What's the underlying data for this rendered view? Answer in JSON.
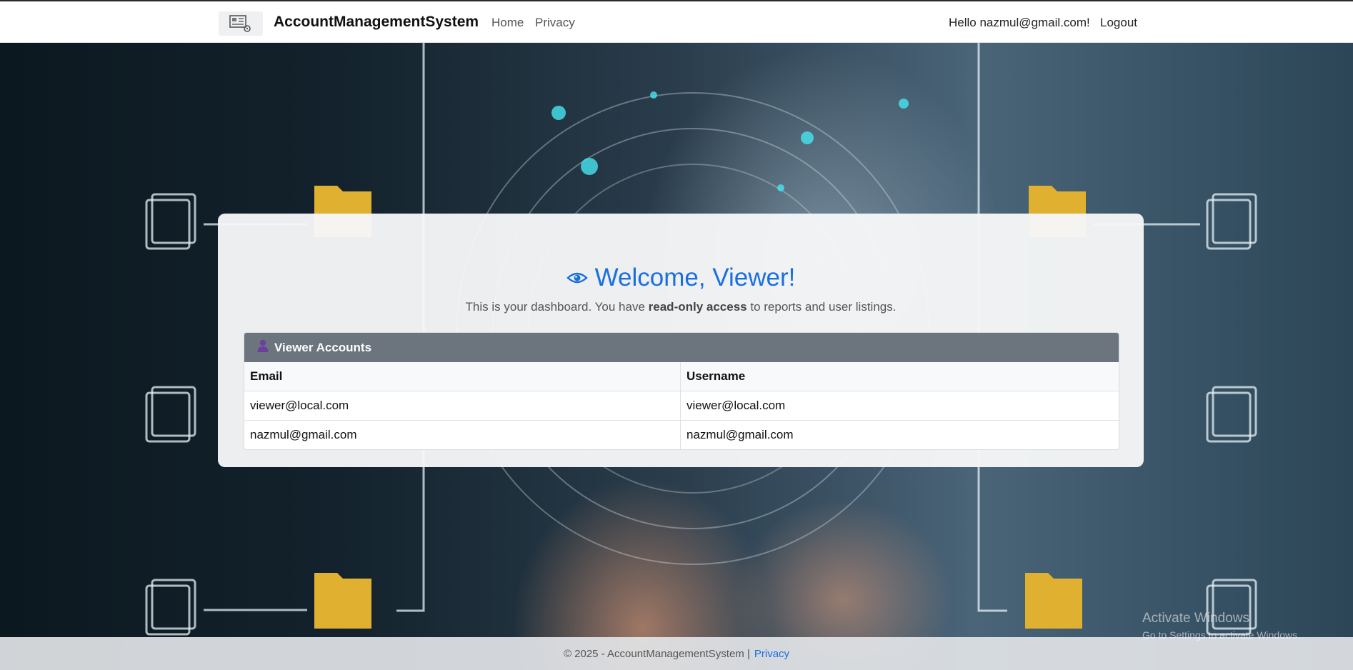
{
  "navbar": {
    "brand": "AccountManagementSystem",
    "links": [
      "Home",
      "Privacy"
    ],
    "greeting": "Hello nazmul@gmail.com!",
    "logout": "Logout"
  },
  "main": {
    "title": "Welcome, Viewer!",
    "subtitle_before": "This is your dashboard. You have ",
    "subtitle_bold": "read-only access",
    "subtitle_after": " to reports and user listings.",
    "panel_title": "Viewer Accounts",
    "columns": [
      "Email",
      "Username"
    ],
    "rows": [
      [
        "viewer@local.com",
        "viewer@local.com"
      ],
      [
        "nazmul@gmail.com",
        "nazmul@gmail.com"
      ]
    ]
  },
  "footer": {
    "text": "© 2025 - AccountManagementSystem |",
    "link": "Privacy"
  },
  "watermark": {
    "line1": "Activate Windows",
    "line2": "Go to Settings to activate Windows."
  },
  "colors": {
    "accent": "#1a6fe0",
    "panel_header": "#6c757d"
  },
  "icons": [
    "brand-logo-icon",
    "eye-icon",
    "user-icon"
  ]
}
